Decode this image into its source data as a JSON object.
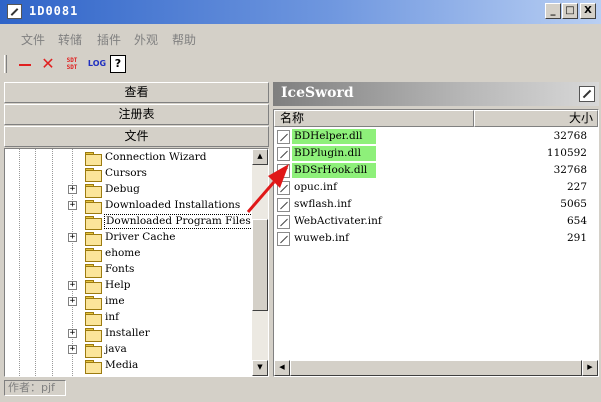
{
  "window": {
    "title": "1D0081",
    "min_glyph": "_",
    "max_glyph": "□",
    "close_glyph": "X"
  },
  "menu": [
    "文件",
    "转储",
    "插件",
    "外观",
    "帮助"
  ],
  "toolbar": {
    "sdt_label": "SDT\nSDT",
    "log_label": "LOG",
    "help_label": "?"
  },
  "left_tabs": [
    "查看",
    "注册表",
    "文件"
  ],
  "tree": [
    {
      "label": "Connection Wizard",
      "expandable": false
    },
    {
      "label": "Cursors",
      "expandable": false
    },
    {
      "label": "Debug",
      "expandable": true
    },
    {
      "label": "Downloaded Installations",
      "expandable": true
    },
    {
      "label": "Downloaded Program Files",
      "expandable": false,
      "selected": true
    },
    {
      "label": "Driver Cache",
      "expandable": true
    },
    {
      "label": "ehome",
      "expandable": false
    },
    {
      "label": "Fonts",
      "expandable": false
    },
    {
      "label": "Help",
      "expandable": true
    },
    {
      "label": "ime",
      "expandable": true
    },
    {
      "label": "inf",
      "expandable": false
    },
    {
      "label": "Installer",
      "expandable": true
    },
    {
      "label": "java",
      "expandable": true
    },
    {
      "label": "Media",
      "expandable": false
    }
  ],
  "status": "作者：pjf",
  "right_panel": {
    "title": "IceSword",
    "columns": [
      "名称",
      "大小"
    ],
    "files": [
      {
        "name": "BDHelper.dll",
        "size": "32768",
        "highlight": true
      },
      {
        "name": "BDPlugin.dll",
        "size": "110592",
        "highlight": true
      },
      {
        "name": "BDSrHook.dll",
        "size": "32768",
        "highlight": true
      },
      {
        "name": "opuc.inf",
        "size": "227",
        "highlight": false
      },
      {
        "name": "swflash.inf",
        "size": "5065",
        "highlight": false
      },
      {
        "name": "WebActivater.inf",
        "size": "654",
        "highlight": false
      },
      {
        "name": "wuweb.inf",
        "size": "291",
        "highlight": false
      }
    ]
  },
  "colors": {
    "highlight": "#8ef07a",
    "arrow": "#e01818"
  },
  "icons": {
    "minimize": "minimize-icon",
    "delete": "delete-icon",
    "sdt": "sdt-icon",
    "log": "log-icon",
    "help": "help-icon"
  }
}
